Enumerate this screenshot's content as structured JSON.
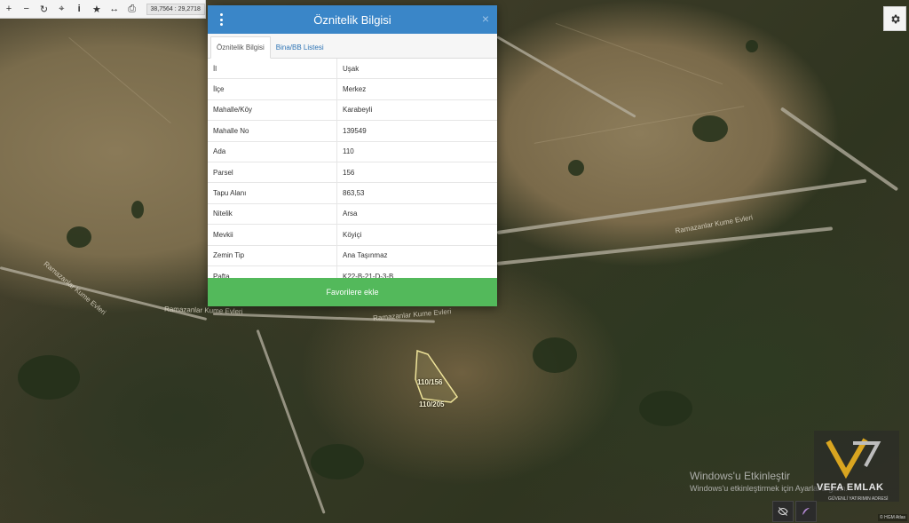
{
  "toolbar": {
    "buttons": [
      {
        "name": "zoom-in",
        "label": "+"
      },
      {
        "name": "zoom-out",
        "label": "−"
      },
      {
        "name": "refresh",
        "label": "↻"
      },
      {
        "name": "locate",
        "label": "⌖"
      },
      {
        "name": "info",
        "label": "i"
      },
      {
        "name": "favorite",
        "label": "★"
      },
      {
        "name": "measure",
        "label": "↔"
      },
      {
        "name": "print",
        "label": "⎙"
      }
    ],
    "coordinates": "38,7564 : 29,2718"
  },
  "modal": {
    "title": "Öznitelik Bilgisi",
    "close_label": "×",
    "tabs": [
      {
        "label": "Öznitelik Bilgisi",
        "active": true
      },
      {
        "label": "Bina/BB Listesi",
        "active": false
      }
    ],
    "rows": [
      {
        "key": "İl",
        "value": "Uşak"
      },
      {
        "key": "İlçe",
        "value": "Merkez"
      },
      {
        "key": "Mahalle/Köy",
        "value": "Karabeyli"
      },
      {
        "key": "Mahalle No",
        "value": "139549"
      },
      {
        "key": "Ada",
        "value": "110"
      },
      {
        "key": "Parsel",
        "value": "156"
      },
      {
        "key": "Tapu Alanı",
        "value": "863,53"
      },
      {
        "key": "Nitelik",
        "value": "Arsa"
      },
      {
        "key": "Mevkii",
        "value": "Köyiçi"
      },
      {
        "key": "Zemin Tip",
        "value": "Ana Taşınmaz"
      },
      {
        "key": "Pafta",
        "value": "K22-B-21-D-3-B"
      }
    ],
    "favorite_button": "Favorilere ekle"
  },
  "map": {
    "parcel_labels": [
      "110/156",
      "110/205"
    ],
    "road_labels": [
      "Ramazanlar Kume Evleri",
      "Ramazanlar Kume Evleri",
      "Ramazanlar Kume Evleri",
      "Ramazanlar Kume Evleri"
    ]
  },
  "watermark": {
    "line1": "Windows'u Etkinleştir",
    "line2": "Windows'u etkinleştirmek için Ayarlar'a gidin."
  },
  "logo": {
    "name": "VEFA EMLAK",
    "tagline": "GÜVENLİ YATIRIMIN ADRESİ"
  },
  "attribution": "© HGM Atlas",
  "colors": {
    "header": "#3a86c8",
    "favorite": "#53b95b",
    "tab_link": "#2e74b5"
  }
}
